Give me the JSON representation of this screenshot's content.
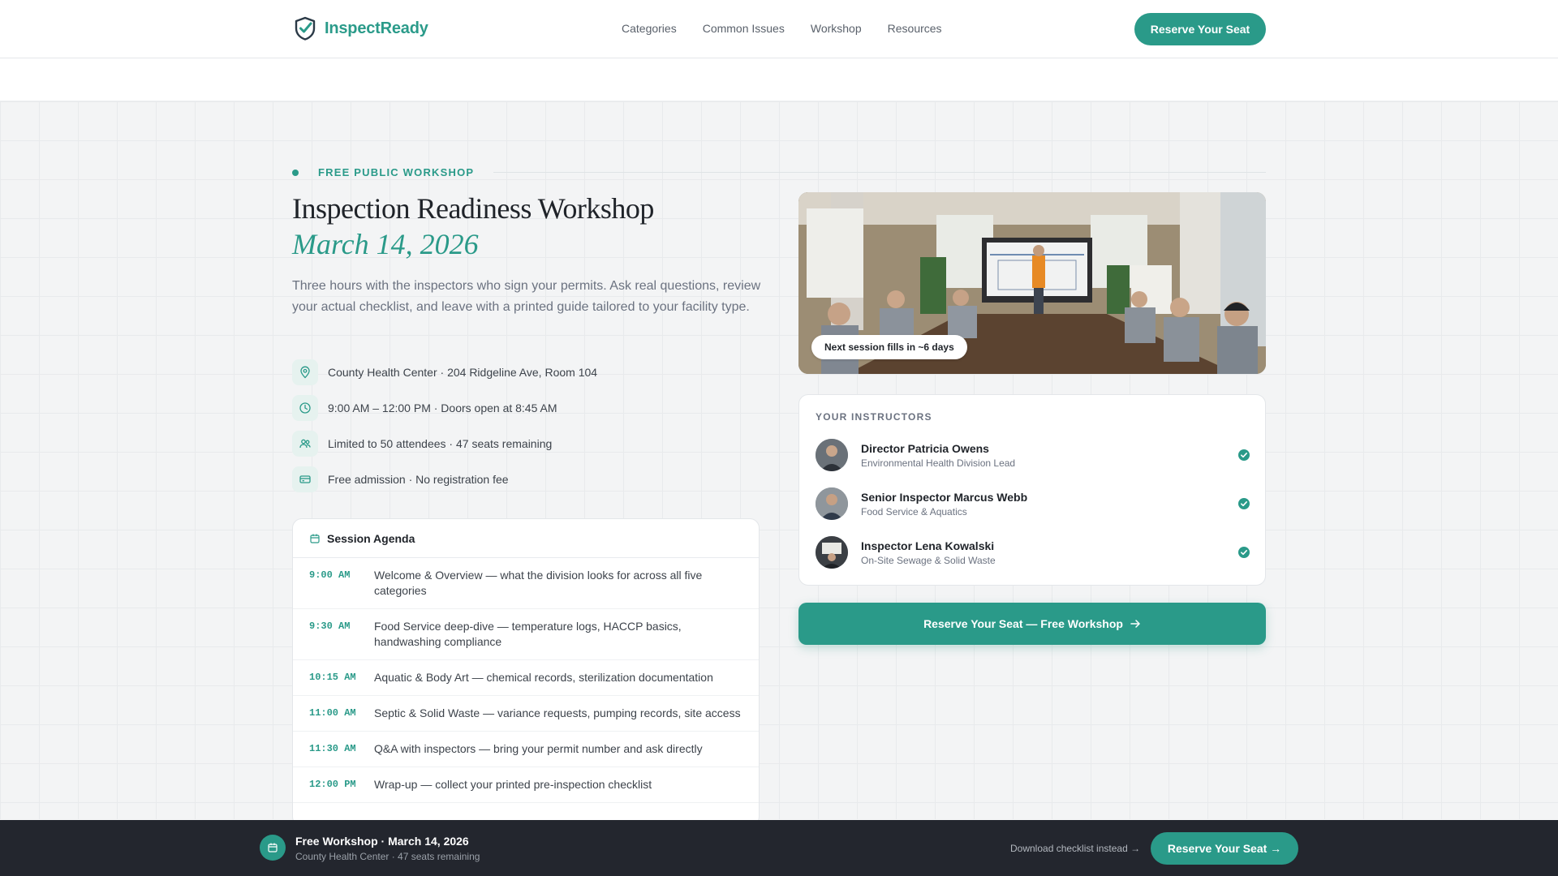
{
  "brand": {
    "name": "InspectReady"
  },
  "nav": {
    "items": [
      "Categories",
      "Common Issues",
      "Workshop",
      "Resources"
    ]
  },
  "header": {
    "cta_label": "Reserve Your Seat"
  },
  "hero": {
    "eyebrow": "FREE PUBLIC WORKSHOP",
    "title": "Inspection Readiness Workshop",
    "date": "March 14, 2026",
    "lead": "Three hours with the inspectors who sign your permits. Ask real questions, review your actual checklist, and leave with a printed guide tailored to your facility type."
  },
  "facts": [
    {
      "icon": "location-pin-icon",
      "text": "County Health Center · 204 Ridgeline Ave, Room 104"
    },
    {
      "icon": "clock-icon",
      "text": "9:00 AM – 12:00 PM · Doors open at 8:45 AM"
    },
    {
      "icon": "people-icon",
      "text": "Limited to 50 attendees · 47 seats remaining"
    },
    {
      "icon": "ticket-icon",
      "text": "Free admission · No registration fee"
    }
  ],
  "agenda": {
    "title": "Session Agenda",
    "items": [
      {
        "time": "9:00 AM",
        "desc": "Welcome & Overview — what the division looks for across all five categories"
      },
      {
        "time": "9:30 AM",
        "desc": "Food Service deep-dive — temperature logs, HACCP basics, handwashing compliance"
      },
      {
        "time": "10:15 AM",
        "desc": "Aquatic & Body Art — chemical records, sterilization documentation"
      },
      {
        "time": "11:00 AM",
        "desc": "Septic & Solid Waste — variance requests, pumping records, site access"
      },
      {
        "time": "11:30 AM",
        "desc": "Q&A with inspectors — bring your permit number and ask directly"
      },
      {
        "time": "12:00 PM",
        "desc": "Wrap-up — collect your printed pre-inspection checklist"
      }
    ]
  },
  "photo": {
    "badge": "Next session fills in ~6 days"
  },
  "instructors": {
    "label": "YOUR INSTRUCTORS",
    "people": [
      {
        "name": "Director Patricia Owens",
        "role": "Environmental Health Division Lead"
      },
      {
        "name": "Senior Inspector Marcus Webb",
        "role": "Food Service & Aquatics"
      },
      {
        "name": "Inspector Lena Kowalski",
        "role": "On-Site Sewage & Solid Waste"
      }
    ]
  },
  "main_cta": {
    "label": "Reserve Your Seat — Free Workshop"
  },
  "bottombar": {
    "title": "Free Workshop · March 14, 2026",
    "subtitle": "County Health Center · 47 seats remaining",
    "link": "Download checklist instead →",
    "cta_label": "Reserve Your Seat →"
  },
  "colors": {
    "accent": "#2a9a89",
    "dark": "#23262e",
    "background": "#f4f5f6"
  }
}
